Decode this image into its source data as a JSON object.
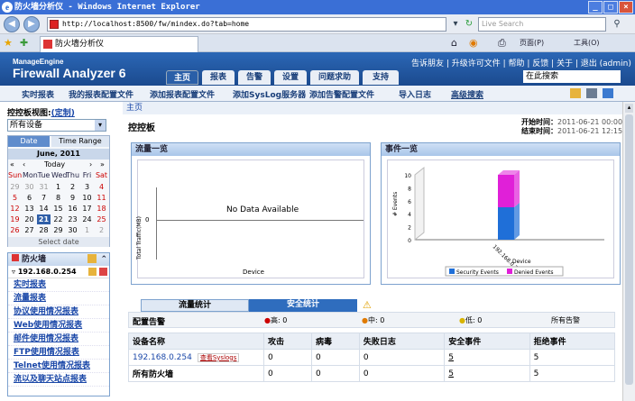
{
  "window": {
    "title": "防火墙分析仪 - Windows Internet Explorer",
    "ie_glyph": "e"
  },
  "address": {
    "url": "http://localhost:8500/fw/mindex.do?tab=home",
    "search_placeholder": "Live Search",
    "go": "→"
  },
  "browser_tab": {
    "title": "防火墙分析仪"
  },
  "browser_tools": {
    "page": "页面(P)",
    "tools": "工具(O)"
  },
  "app": {
    "brand_top": "ManageEngine",
    "brand": "Firewall Analyzer 6",
    "tabs": [
      "主页",
      "报表",
      "告警",
      "设置",
      "问题求助",
      "支持"
    ],
    "top_links": "告诉朋友 | 升级许可文件 | 帮助 | 反馈 | 关于 | 退出 (admin)",
    "search_placeholder": "在此搜索",
    "subnav": [
      "实时报表",
      "我的报表配置文件",
      "添加报表配置文件",
      "添加SysLog服务器",
      "添加告警配置文件",
      "导入日志",
      "高级搜索"
    ]
  },
  "breadcrumb": "主页",
  "dashboard": {
    "title": "控控板",
    "start_label": "开始时间：",
    "start_value": "2011-06-21 00:00:00",
    "end_label": "结束时间：",
    "end_value": "2011-06-21 12:15:00"
  },
  "left": {
    "view_label": "控控板视图:",
    "customize": "(定制)",
    "select_value": "所有设备",
    "cal_tabs": [
      "Date",
      "Time Range"
    ],
    "cal_month": "June, 2011",
    "today": "Today",
    "cal_days": [
      "Sun",
      "Mon",
      "Tue",
      "Wed",
      "Thu",
      "Fri",
      "Sat"
    ],
    "cal_rows": [
      [
        "29",
        "30",
        "31",
        "1",
        "2",
        "3",
        "4"
      ],
      [
        "5",
        "6",
        "7",
        "8",
        "9",
        "10",
        "11"
      ],
      [
        "12",
        "13",
        "14",
        "15",
        "16",
        "17",
        "18"
      ],
      [
        "19",
        "20",
        "21",
        "22",
        "23",
        "24",
        "25"
      ],
      [
        "26",
        "27",
        "28",
        "29",
        "30",
        "1",
        "2"
      ]
    ],
    "select_date": "Select date",
    "fw_title": "防火墙",
    "device": "192.168.0.254",
    "links": [
      "实时报表",
      "流量报表",
      "协议使用情况报表",
      "Web使用情况报表",
      "邮件使用情况报表",
      "FTP使用情况报表",
      "Telnet使用情况报表",
      "流以及聊天站点报表"
    ]
  },
  "traffic_chart": {
    "title": "流量一览",
    "message": "No Data Available",
    "ylabel": "Total Traffic(MB)",
    "xlabel": "Device",
    "tick0": "0"
  },
  "event_chart": {
    "title": "事件一览",
    "ylabel": "# Events",
    "xlabel": "Device",
    "legend": [
      "Security Events",
      "Denied Events"
    ],
    "colors": [
      "#1f6fd8",
      "#e020d8"
    ]
  },
  "chart_data": {
    "type": "bar",
    "categories": [
      "192.168.0.254"
    ],
    "series": [
      {
        "name": "Security Events",
        "values": [
          5
        ]
      },
      {
        "name": "Denied Events",
        "values": [
          5
        ]
      }
    ],
    "ylabel": "# Events",
    "xlabel": "Device",
    "ylim": [
      0,
      10
    ],
    "yticks": [
      "0",
      "2",
      "4",
      "6",
      "8",
      "10"
    ]
  },
  "stats": {
    "tabs": [
      "流量统计",
      "安全统计"
    ],
    "alert_label": "配置告警",
    "high": "高: 0",
    "mid": "中: 0",
    "low": "低: 0",
    "all": "所有告警",
    "headers": [
      "设备名称",
      "攻击",
      "病毒",
      "失败日志",
      "安全事件",
      "拒绝事件"
    ],
    "rows": [
      {
        "device": "192.168.0.254",
        "link": "查看Syslogs",
        "vals": [
          "0",
          "0",
          "0",
          "5",
          "5"
        ]
      },
      {
        "device": "所有防火墙",
        "link": "",
        "vals": [
          "0",
          "0",
          "0",
          "5",
          "5"
        ]
      }
    ]
  }
}
